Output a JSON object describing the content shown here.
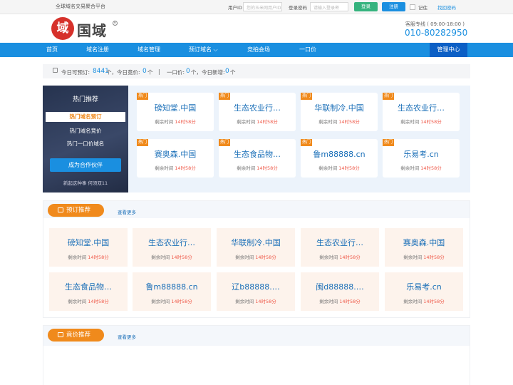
{
  "topbar": {
    "slogan": "全球域名交易聚合平台",
    "user_label": "用户ID",
    "user_placeholder": "您的玉米网用户ID",
    "pwd_label": "登录密码",
    "pwd_placeholder": "请输入登录密",
    "login": "登录",
    "register": "注册",
    "remember": "记住",
    "forgot": "找回密码"
  },
  "header": {
    "logo_mark": "域",
    "logo_name": "国域",
    "logo_reg": "R",
    "hotline_label": "客服专线 ( 09:00-18:00 )",
    "hotline_number": "010-80282950"
  },
  "nav": {
    "items": [
      "首页",
      "域名注册",
      "域名管理",
      "预订域名",
      "竞拍会场",
      "一口价"
    ],
    "dropdown_arrow": "⌵",
    "manage": "管理中心"
  },
  "stats": {
    "p1": "今日可预订:",
    "count1": "8441",
    "p2": "个，今日竟价:",
    "count2": "0",
    "p3": "个",
    "sep": "|",
    "p4": "一口价:",
    "count3": "0",
    "p5": "个，今日新增:",
    "count4": "0",
    "p6": "个"
  },
  "hot": {
    "title": "热门推荐",
    "items": [
      "热门域名预订",
      "热门域名竞价",
      "热门一口价域名"
    ],
    "partner": "成为合作伙伴",
    "foot": "新起这种事 何须双11",
    "tag": "热门",
    "time_label": "剩余时间",
    "time_value": "14时58分",
    "cards": [
      "磅知堂.中国",
      "生态农业行…",
      "华联制冷.中国",
      "生态农业行…",
      "赛奥森.中国",
      "生态食品物…",
      "鲁m88888.cn",
      "乐易考.cn"
    ]
  },
  "preorder": {
    "title": "预订推荐",
    "more": "查看更多",
    "time_label": "剩余时间",
    "time_value": "14时58分",
    "cards": [
      "磅知堂.中国",
      "生态农业行…",
      "华联制冷.中国",
      "生态农业行…",
      "赛奥森.中国",
      "生态食品物…",
      "鲁m88888.cn",
      "辽b88888.…",
      "闽d88888.…",
      "乐易考.cn"
    ]
  },
  "auction": {
    "title": "竟价推荐",
    "more": "查看更多"
  },
  "colors": {
    "brand_blue": "#1a8fe0",
    "orange": "#f08a1c",
    "red": "#ef5a4a"
  }
}
